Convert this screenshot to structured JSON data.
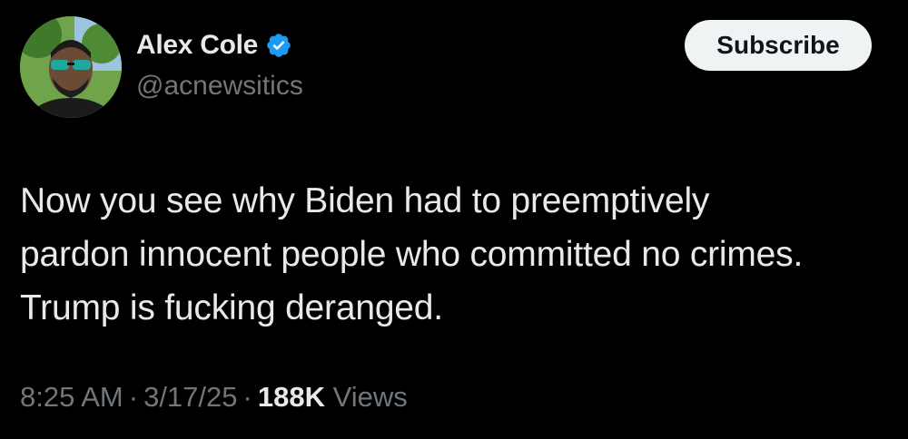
{
  "author": {
    "display_name": "Alex Cole",
    "handle": "@acnewsitics",
    "verified": true,
    "verified_color": "#1d9bf0"
  },
  "actions": {
    "subscribe_label": "Subscribe"
  },
  "tweet": {
    "lines": [
      "Now you see why Biden had to preemptively",
      "pardon innocent people who committed no crimes.",
      "Trump is fucking deranged."
    ]
  },
  "meta": {
    "time": "8:25 AM",
    "date": "3/17/25",
    "separator": "·",
    "views_count": "188K",
    "views_label": "Views"
  },
  "colors": {
    "background": "#000000",
    "primary_text": "#e7e9ea",
    "secondary_text": "#71767b",
    "button_bg": "#eff3f4"
  }
}
